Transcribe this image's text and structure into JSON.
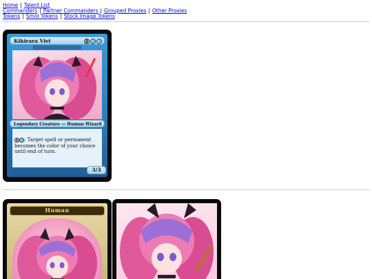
{
  "nav": {
    "row1": [
      "Home",
      "Talent List"
    ],
    "row2": [
      "Commanders",
      "Partner Commanders",
      "Grouped Proxies",
      "Other Proxies"
    ],
    "row3": [
      "Tokens",
      "Smol Tokens",
      "Stock Image Tokens"
    ]
  },
  "main_card": {
    "name": "Kikirara Vivi",
    "mana": [
      "2",
      "💧",
      "💧"
    ],
    "type_line": "Legendary Creature — Human Wizard",
    "rules_cost": [
      "1",
      "💧"
    ],
    "rules_text": ": Target spell or permanent becomes the color of your choice until end of turn.",
    "pt": "3/3"
  },
  "token_card": {
    "name": "Human"
  },
  "colors": {
    "card_blue": "#2a7fc0",
    "link": "#0000ee"
  }
}
